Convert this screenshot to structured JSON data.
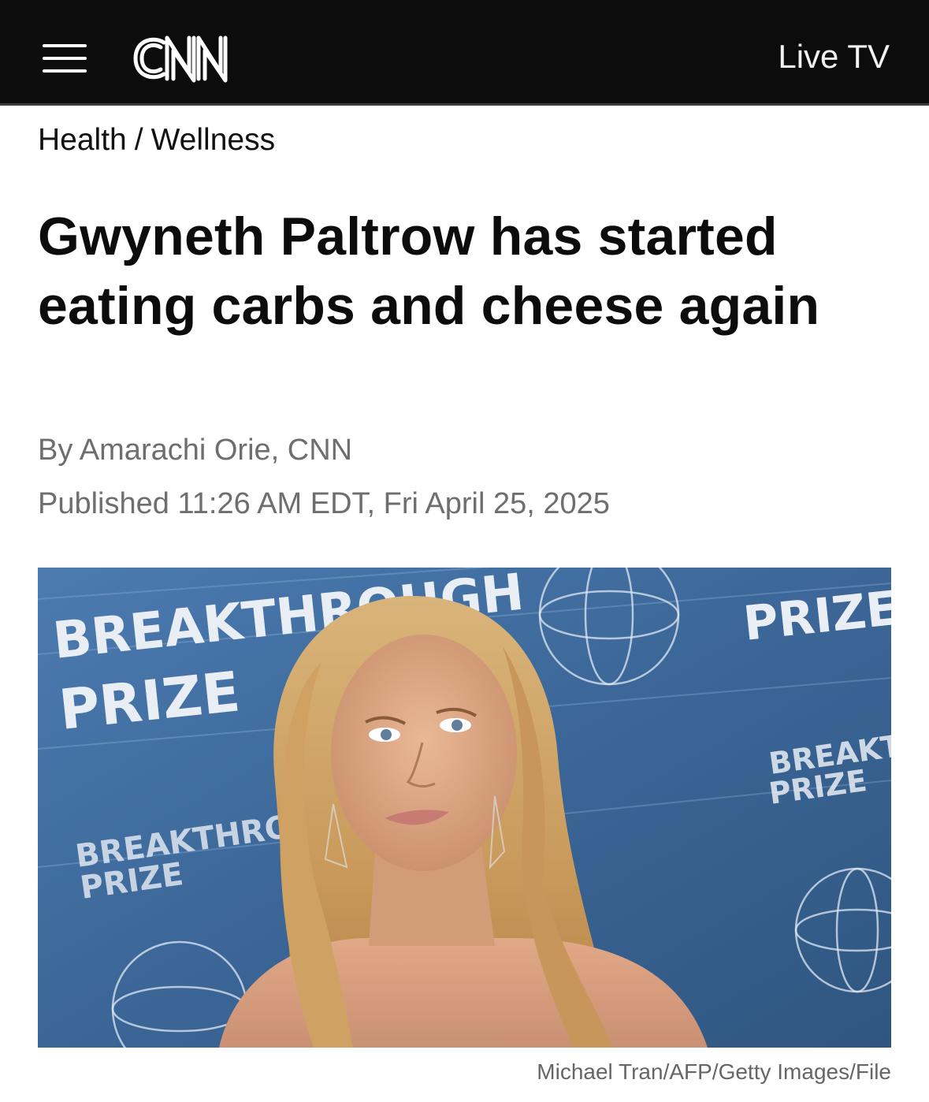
{
  "header": {
    "logo_text": "CNN",
    "live_tv_label": "Live TV"
  },
  "breadcrumb": {
    "section": "Health",
    "subsection": "Wellness",
    "separator": "/"
  },
  "article": {
    "headline": "Gwyneth Paltrow has started eating carbs and cheese again",
    "byline": "By Amarachi Orie, CNN",
    "published": "Published 11:26 AM EDT, Fri April 25, 2025"
  },
  "hero_image": {
    "backdrop_text_1": "BREAKTHROUGH",
    "backdrop_text_2": "PRIZE",
    "caption": "Michael Tran/AFP/Getty Images/File"
  },
  "colors": {
    "topbar_bg": "#0c0c0c",
    "headline": "#0c0c0c",
    "meta_gray": "#6e6e6e",
    "backdrop_blue": "#3f6ea1"
  }
}
